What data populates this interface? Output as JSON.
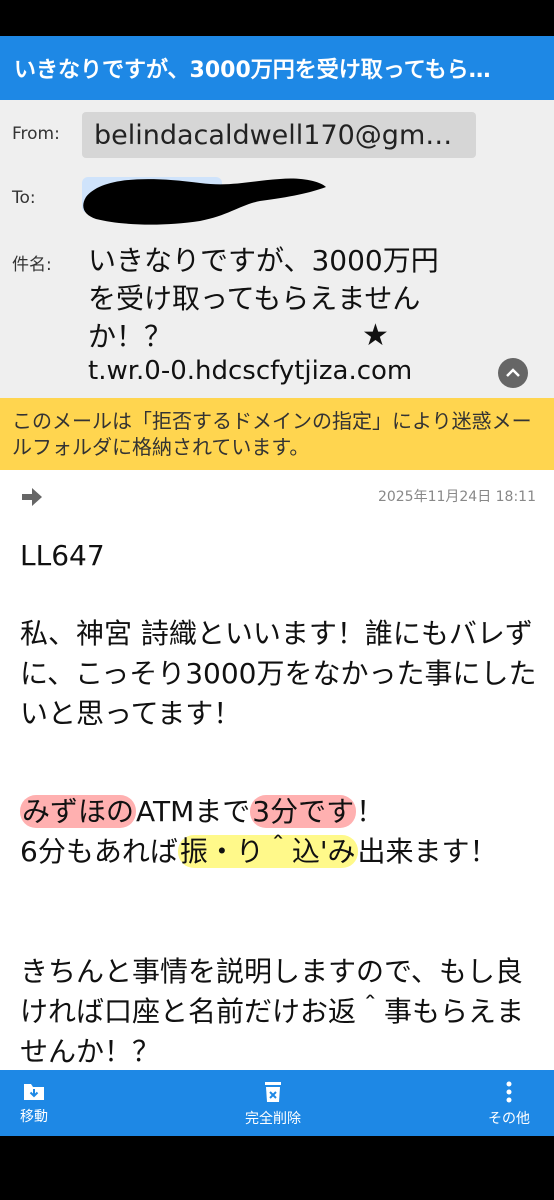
{
  "title_bar": {
    "title": "いきなりですが、3000万円を受け取ってもら…"
  },
  "header": {
    "from_label": "From:",
    "from_value": "belindacaldwell170@gm…",
    "to_label": "To:",
    "subject_label": "件名:",
    "subject_text": "いきなりですが、3000万円を受け取ってもらえませんか！？",
    "subject_star": "★",
    "subject_domain": "t.wr.0-0.hdcscfytjiza.com"
  },
  "warning": {
    "text": "このメールは「拒否するドメインの指定」により迷惑メールフォルダに格納されています。"
  },
  "message": {
    "date": "2025年11月24日 18:11",
    "code": "LL647",
    "intro": "私、神宮 詩織といいます！誰にもバレずに、こっそり3000万をなかった事にしたいと思ってます！",
    "atm_red1": "みずほの",
    "atm_mid": "ATMまで",
    "atm_red2": "3分です",
    "atm_end": "！",
    "transfer_start": "6分もあれば",
    "transfer_hl": "振・り＾込'み",
    "transfer_end": "出来ます！",
    "explain": "きちんと事情を説明しますので、もし良ければ口座と名前だけお返＾事もらえませんか！？"
  },
  "toolbar": {
    "move_label": "移動",
    "delete_label": "完全削除",
    "other_label": "その他"
  },
  "colors": {
    "accent": "#1e88e5",
    "warning": "#ffd54f",
    "header_bg": "#efefef"
  }
}
